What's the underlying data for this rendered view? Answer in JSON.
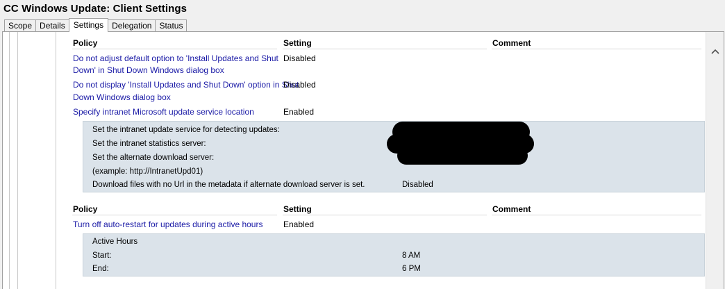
{
  "window": {
    "title": "CC Windows Update: Client Settings"
  },
  "tabs": [
    {
      "label": "Scope"
    },
    {
      "label": "Details"
    },
    {
      "label": "Settings"
    },
    {
      "label": "Delegation"
    },
    {
      "label": "Status"
    }
  ],
  "active_tab": "Settings",
  "table1": {
    "headers": {
      "policy": "Policy",
      "setting": "Setting",
      "comment": "Comment"
    },
    "rows": [
      {
        "policy_line1": "Do not adjust default option to 'Install Updates and Shut",
        "policy_line2": "Down' in Shut Down Windows dialog box",
        "setting": "Disabled"
      },
      {
        "policy_line1": "Do not display 'Install Updates and Shut Down' option in Shut",
        "policy_line2": "Down Windows dialog box",
        "setting": "Disabled"
      },
      {
        "policy_line1": "Specify intranet Microsoft update service location",
        "setting": "Enabled"
      }
    ],
    "details": [
      {
        "label": "Set the intranet update service for detecting updates:",
        "value": ""
      },
      {
        "label": "Set the intranet statistics server:",
        "value": ""
      },
      {
        "label": "Set the alternate download server:",
        "value": ""
      },
      {
        "label": "(example: http://IntranetUpd01)",
        "value": ""
      },
      {
        "label": "Download files with no Url in the metadata if alternate download server is set.",
        "value": "Disabled"
      }
    ]
  },
  "table2": {
    "headers": {
      "policy": "Policy",
      "setting": "Setting",
      "comment": "Comment"
    },
    "rows": [
      {
        "policy_line1": "Turn off auto-restart for updates during active hours",
        "setting": "Enabled"
      }
    ],
    "details": [
      {
        "label": "Active Hours",
        "value": ""
      },
      {
        "label": "Start:",
        "value": "8 AM"
      },
      {
        "label": "End:",
        "value": "6 PM"
      }
    ]
  },
  "colors": {
    "link": "#1a1aa6",
    "panel": "#dbe3ea",
    "background": "#f0f0f0"
  },
  "icons": {
    "scroll_up": "chevron-up-icon"
  }
}
